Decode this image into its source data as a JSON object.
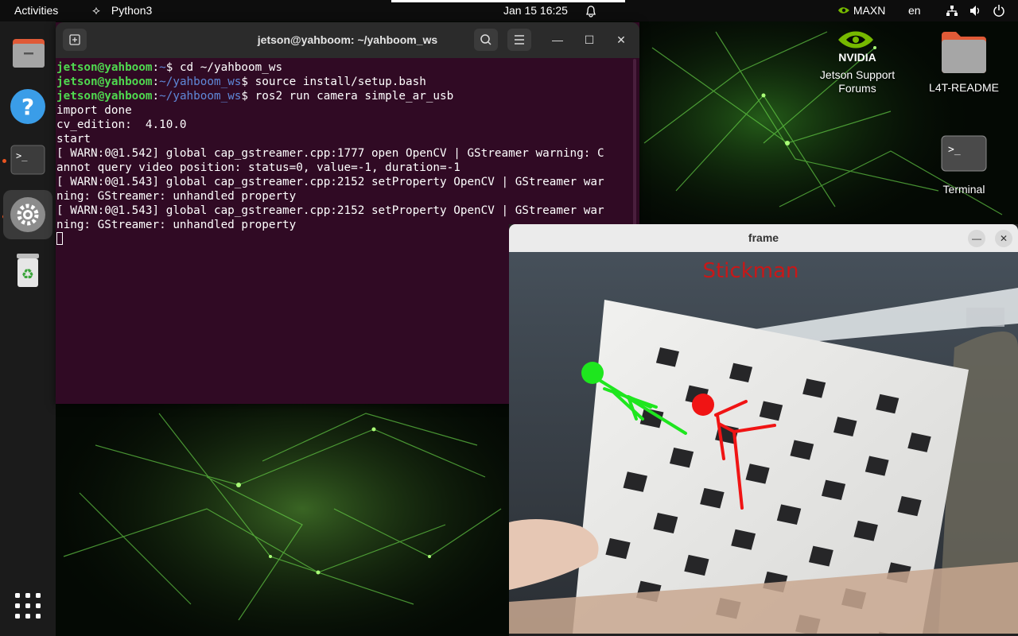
{
  "topbar": {
    "activities": "Activities",
    "app_name": "Python3",
    "datetime": "Jan 15  16:25",
    "power_mode": "MAXN",
    "language": "en"
  },
  "dock": {
    "items": [
      "files-icon",
      "help-icon",
      "terminal-icon",
      "settings-icon",
      "trash-icon"
    ],
    "show_apps": "apps-grid-icon"
  },
  "desktop": {
    "nvidia_logo_text": "NVIDIA",
    "icons": [
      {
        "label": "Jetson Support Forums",
        "line1": "Jetson Support",
        "line2": "Forums"
      },
      {
        "label": "L4T-README"
      },
      {
        "label": "Terminal"
      }
    ]
  },
  "terminal": {
    "title": "jetson@yahboom: ~/yahboom_ws",
    "prompt_user": "jetson@yahboom",
    "lines": [
      {
        "type": "prompt",
        "path": "~",
        "cmd": " cd ~/yahboom_ws"
      },
      {
        "type": "prompt",
        "path": "~/yahboom_ws",
        "cmd": " source install/setup.bash"
      },
      {
        "type": "prompt",
        "path": "~/yahboom_ws",
        "cmd": " ros2 run camera simple_ar_usb"
      },
      {
        "type": "out",
        "text": "import done"
      },
      {
        "type": "out",
        "text": "cv_edition:  4.10.0"
      },
      {
        "type": "out",
        "text": "start"
      },
      {
        "type": "out",
        "text": "[ WARN:0@1.542] global cap_gstreamer.cpp:1777 open OpenCV | GStreamer warning: C"
      },
      {
        "type": "out",
        "text": "annot query video position: status=0, value=-1, duration=-1"
      },
      {
        "type": "out",
        "text": "[ WARN:0@1.543] global cap_gstreamer.cpp:2152 setProperty OpenCV | GStreamer war"
      },
      {
        "type": "out",
        "text": "ning: GStreamer: unhandled property"
      },
      {
        "type": "out",
        "text": "[ WARN:0@1.543] global cap_gstreamer.cpp:2152 setProperty OpenCV | GStreamer war"
      },
      {
        "type": "out",
        "text": "ning: GStreamer: unhandled property"
      }
    ]
  },
  "frame_window": {
    "title": "frame",
    "overlay_text": "Stickman",
    "overlay_color": "#c81818",
    "green_figure_color": "#1ee61e",
    "red_figure_color": "#f01414"
  },
  "colors": {
    "terminal_bg": "#300a24",
    "prompt_user": "#4fd84f",
    "prompt_path": "#5f88d8",
    "accent": "#e95420"
  }
}
